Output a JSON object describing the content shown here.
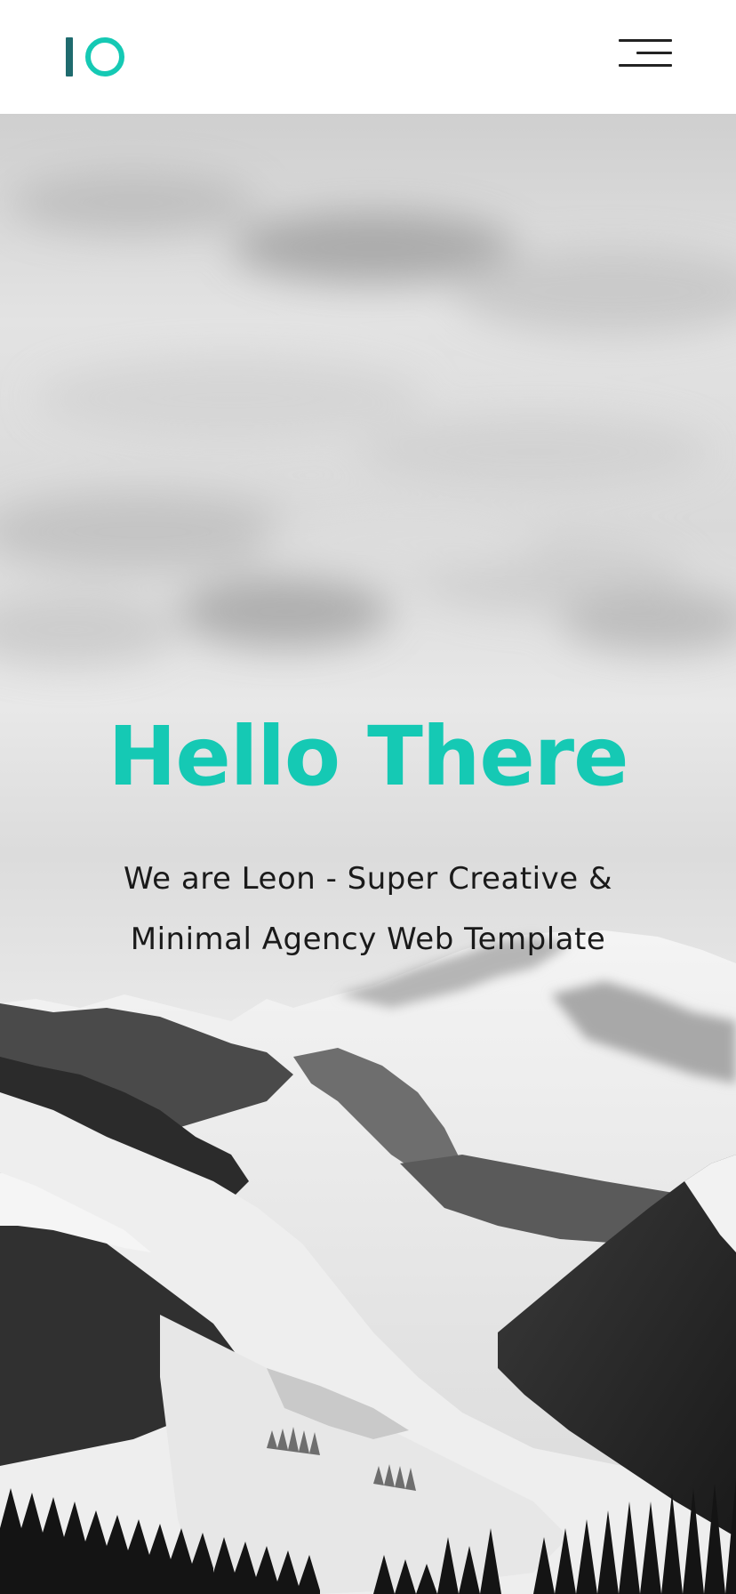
{
  "header": {
    "logo": {
      "name": "IO logo",
      "colors": {
        "bar": "#1f6b6e",
        "ring": "#15c9b4"
      }
    },
    "menu_icon": "hamburger-menu-icon"
  },
  "hero": {
    "title": "Hello There",
    "subtitle": "We are Leon - Super Creative & Minimal Agency Web Template",
    "title_color": "#15c9b4",
    "background_image": "black-and-white snowy mountain range under cloudy sky"
  }
}
